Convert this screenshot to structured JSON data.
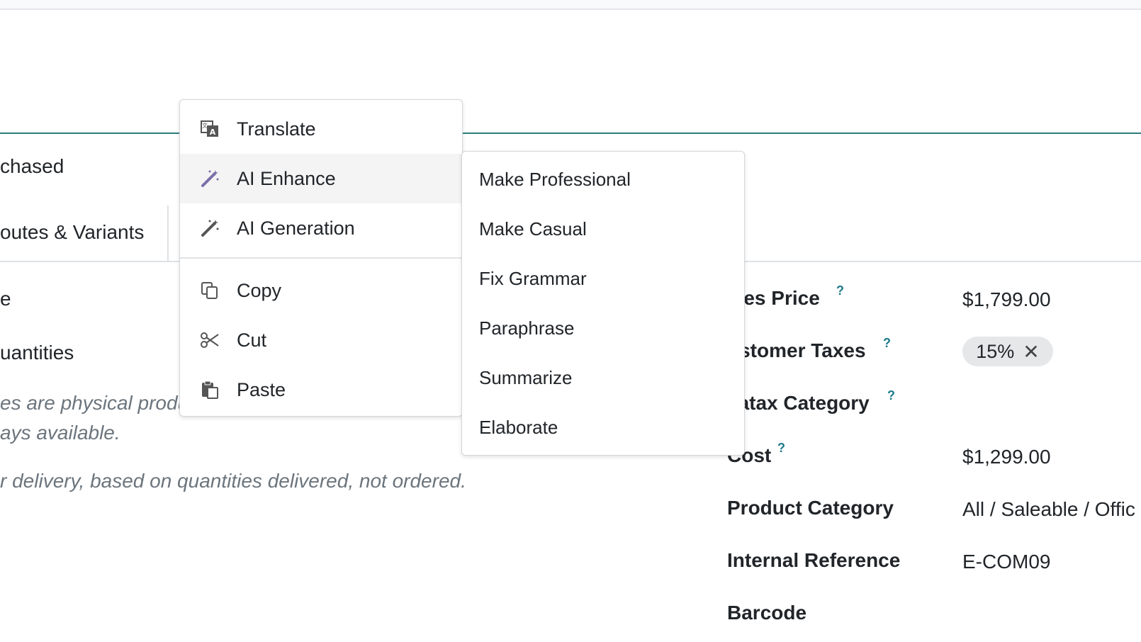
{
  "background": {
    "heading_fragment": "chased",
    "tab_fragment": "outes & Variants",
    "left_fragment_1": "e",
    "left_fragment_2": "uantities",
    "description_line_1": "es are physical produ",
    "description_line_2": "ays available.",
    "description_line_3": "r delivery, based on quantities delivered, not ordered."
  },
  "fields": [
    {
      "label": "ales Price",
      "help": "?",
      "value": "$1,799.00"
    },
    {
      "label": "ustomer Taxes",
      "help": "?",
      "value": ""
    },
    {
      "label": "vatax Category",
      "help": "?",
      "value": ""
    },
    {
      "label": "Cost",
      "help": "?",
      "value": "$1,299.00"
    },
    {
      "label": "Product Category",
      "help": "",
      "value": "All / Saleable / Offic"
    },
    {
      "label": "Internal Reference",
      "help": "",
      "value": "E-COM09"
    },
    {
      "label": "Barcode",
      "help": "",
      "value": ""
    }
  ],
  "tax_badge": {
    "label": "15%",
    "remove": "✕"
  },
  "context_menu": {
    "items": [
      {
        "label": "Translate",
        "icon": "translate-icon"
      },
      {
        "label": "AI Enhance",
        "icon": "magic-wand-icon"
      },
      {
        "label": "AI Generation",
        "icon": "magic-wand-icon"
      },
      {
        "label": "Copy",
        "icon": "copy-icon"
      },
      {
        "label": "Cut",
        "icon": "scissors-icon"
      },
      {
        "label": "Paste",
        "icon": "paste-icon"
      }
    ]
  },
  "submenu": {
    "items": [
      {
        "label": "Make Professional"
      },
      {
        "label": "Make Casual"
      },
      {
        "label": "Fix Grammar"
      },
      {
        "label": "Paraphrase"
      },
      {
        "label": "Summarize"
      },
      {
        "label": "Elaborate"
      }
    ]
  },
  "colors": {
    "accent_teal": "#2d7c7c",
    "help_mark": "#1c7a8a",
    "menu_active_bg": "#f4f4f5",
    "wand_color": "#7b6ea8"
  }
}
